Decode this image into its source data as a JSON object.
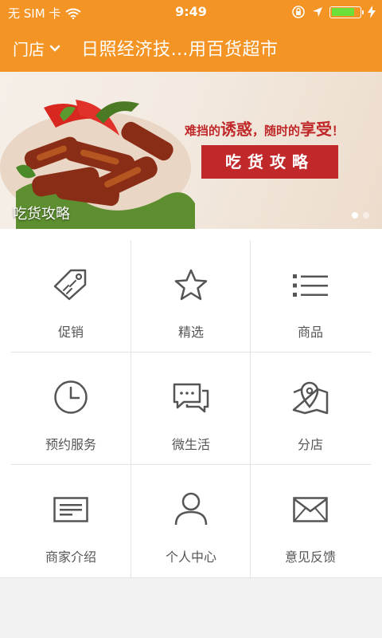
{
  "status_bar": {
    "carrier": "无 SIM 卡",
    "time": "9:49",
    "icons": [
      "wifi-icon",
      "rotation-lock-icon",
      "location-arrow-icon",
      "battery-icon",
      "charging-bolt-icon"
    ],
    "battery_level": 0.8
  },
  "nav": {
    "store_label": "门店",
    "title": "日照经济技…用百货超市",
    "background_color": "#f39424"
  },
  "banner": {
    "slogan_part1": "难挡的",
    "slogan_emph1": "诱惑",
    "slogan_part2": "，随时的",
    "slogan_emph2": "享受",
    "slogan_end": "！",
    "button_label": "吃货攻略",
    "caption": "吃货攻略",
    "slide_count": 2,
    "active_slide": 1,
    "accent_color": "#c0282a"
  },
  "menu": {
    "items": [
      {
        "label": "促销",
        "icon": "price-tag-icon"
      },
      {
        "label": "精选",
        "icon": "star-icon"
      },
      {
        "label": "商品",
        "icon": "list-icon"
      },
      {
        "label": "预约服务",
        "icon": "clock-icon"
      },
      {
        "label": "微生活",
        "icon": "chat-bubbles-icon"
      },
      {
        "label": "分店",
        "icon": "map-pin-icon"
      },
      {
        "label": "商家介绍",
        "icon": "card-icon"
      },
      {
        "label": "个人中心",
        "icon": "user-icon"
      },
      {
        "label": "意见反馈",
        "icon": "envelope-icon"
      }
    ]
  }
}
